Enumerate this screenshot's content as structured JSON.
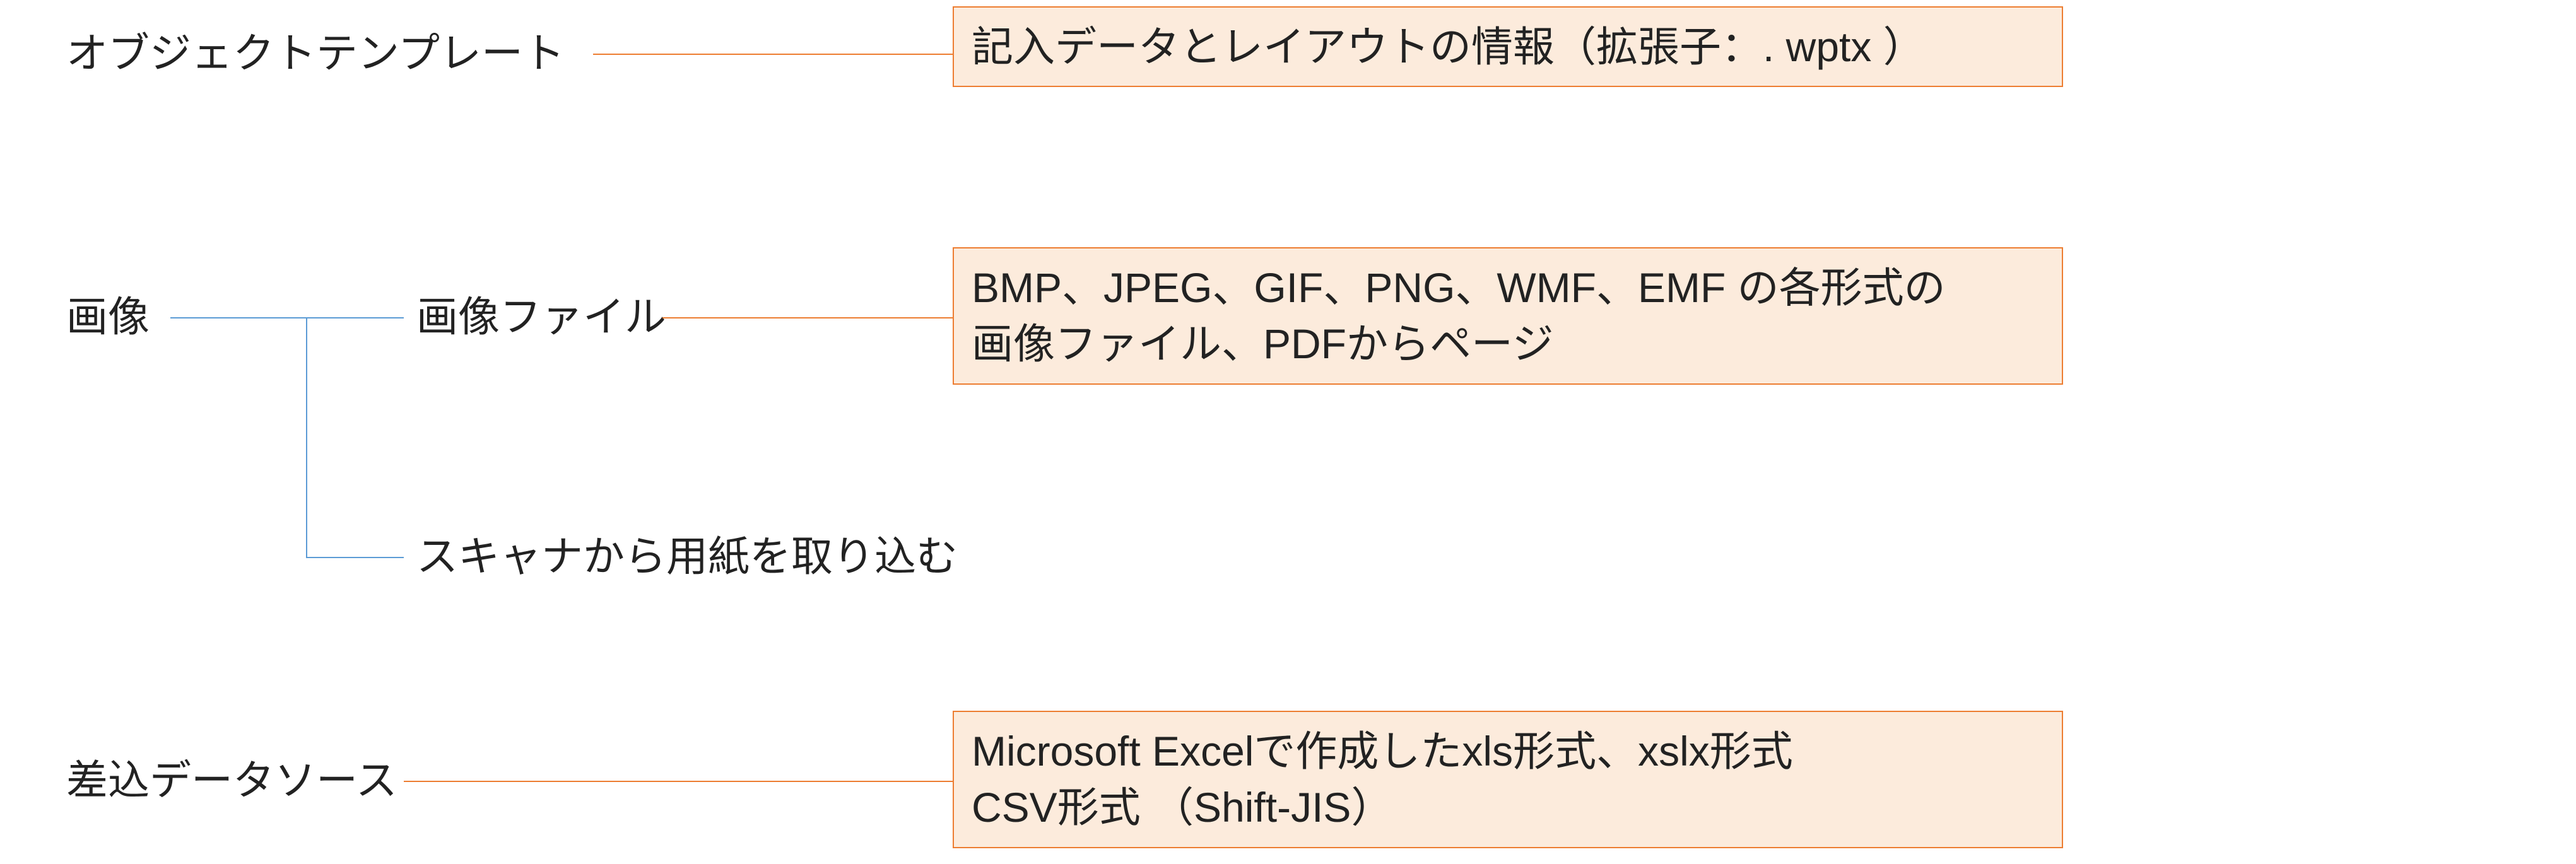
{
  "row1": {
    "left_label": "オブジェクトテンプレート",
    "box_text": "記入データとレイアウトの情報（拡張子：. wptx ）"
  },
  "row2": {
    "left_label": "画像",
    "branch1_label": "画像ファイル",
    "branch1_box": "BMP、JPEG、GIF、PNG、WMF、EMF の各形式の\n画像ファイル、PDFからページ",
    "branch2_label": "スキャナから用紙を取り込む"
  },
  "row3": {
    "left_label": "差込データソース",
    "box_text": "Microsoft Excelで作成したxls形式、xslx形式\nCSV形式 （Shift-JIS）"
  },
  "colors": {
    "box_border": "#ed7d31",
    "box_fill": "#fcebdc",
    "connector_orange": "#ed7d31",
    "connector_blue": "#5b9bd5",
    "text": "#222222"
  }
}
